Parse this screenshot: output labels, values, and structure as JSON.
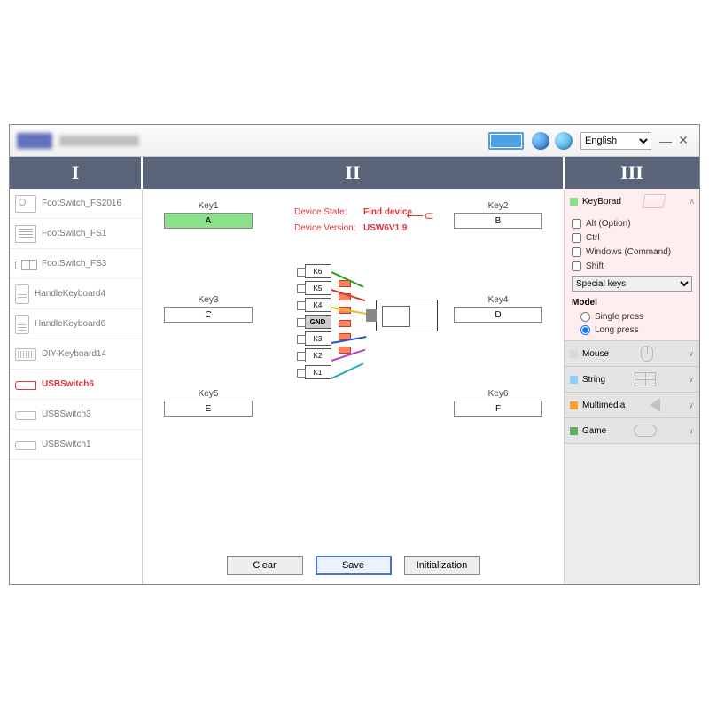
{
  "titlebar": {
    "language_value": "English",
    "min": "—",
    "close": "✕"
  },
  "columns": {
    "c1": "I",
    "c2": "II",
    "c3": "III"
  },
  "devices": [
    {
      "label": "FootSwitch_FS2016",
      "iconcls": "di-ped"
    },
    {
      "label": "FootSwitch_FS1",
      "iconcls": "di-calc"
    },
    {
      "label": "FootSwitch_FS3",
      "iconcls": "di-ped3"
    },
    {
      "label": "HandleKeyboard4",
      "iconcls": "di-hk"
    },
    {
      "label": "HandleKeyboard6",
      "iconcls": "di-hk"
    },
    {
      "label": "DIY-Keyboard14",
      "iconcls": "di-diy"
    },
    {
      "label": "USBSwitch6",
      "iconcls": "di-usb",
      "active": true
    },
    {
      "label": "USBSwitch3",
      "iconcls": "di-usb"
    },
    {
      "label": "USBSwitch1",
      "iconcls": "di-usb"
    }
  ],
  "center": {
    "state_label": "Device State:",
    "state_value": "Find device",
    "version_label": "Device Version:",
    "version_value": "USW6V1.9",
    "keys": [
      {
        "label": "Key1",
        "value": "A",
        "selected": true
      },
      {
        "label": "Key2",
        "value": "B"
      },
      {
        "label": "Key3",
        "value": "C"
      },
      {
        "label": "Key4",
        "value": "D"
      },
      {
        "label": "Key5",
        "value": "E"
      },
      {
        "label": "Key6",
        "value": "F"
      }
    ],
    "pins": [
      "K6",
      "K5",
      "K4",
      "GND",
      "K3",
      "K2",
      "K1"
    ],
    "buttons": {
      "clear": "Clear",
      "save": "Save",
      "init": "Initialization"
    }
  },
  "panel": {
    "keyboard": {
      "title": "KeyBorad",
      "alt": "Alt (Option)",
      "ctrl": "Ctrl",
      "win": "Windows (Command)",
      "shift": "Shift",
      "special_selected": "Special keys",
      "model_label": "Model",
      "single": "Single press",
      "long": "Long press"
    },
    "mouse": "Mouse",
    "string": "String",
    "multimedia": "Multimedia",
    "game": "Game"
  }
}
